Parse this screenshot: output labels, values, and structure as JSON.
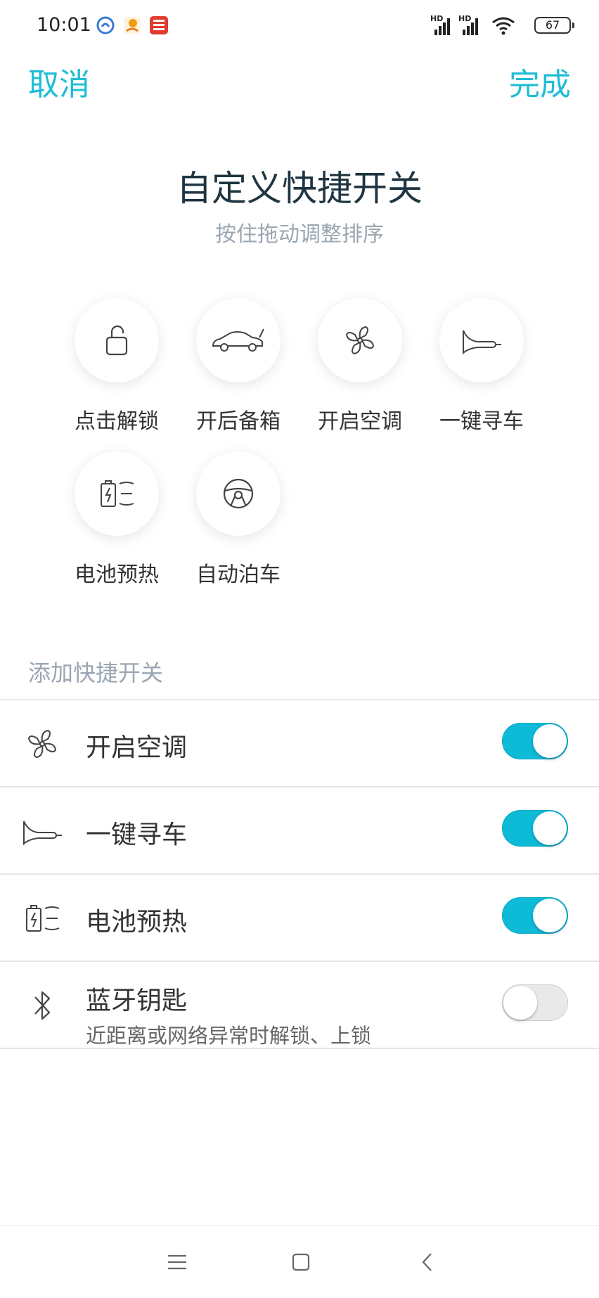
{
  "status_bar": {
    "time": "10:01",
    "hd_labels": [
      "HD",
      "HD"
    ],
    "battery": "67"
  },
  "header": {
    "cancel": "取消",
    "done": "完成"
  },
  "title": "自定义快捷开关",
  "subtitle": "按住拖动调整排序",
  "shortcuts": [
    {
      "label": "点击解锁",
      "icon": "unlock-icon"
    },
    {
      "label": "开后备箱",
      "icon": "car-trunk-icon"
    },
    {
      "label": "开启空调",
      "icon": "fan-icon"
    },
    {
      "label": "一键寻车",
      "icon": "horn-icon"
    },
    {
      "label": "电池预热",
      "icon": "battery-heat-icon"
    },
    {
      "label": "自动泊车",
      "icon": "steering-wheel-icon"
    }
  ],
  "add_section": {
    "title": "添加快捷开关",
    "items": [
      {
        "label": "开启空调",
        "icon": "fan-icon",
        "enabled": true
      },
      {
        "label": "一键寻车",
        "icon": "horn-icon",
        "enabled": true
      },
      {
        "label": "电池预热",
        "icon": "battery-heat-icon",
        "enabled": true
      },
      {
        "label": "蓝牙钥匙",
        "sublabel": "近距离或网络异常时解锁、上锁",
        "icon": "bluetooth-icon",
        "enabled": false
      }
    ]
  },
  "colors": {
    "accent": "#1ebdd6",
    "toggle_on": "#0dbbd7",
    "title": "#1f3441",
    "muted": "#9aa6b2"
  }
}
